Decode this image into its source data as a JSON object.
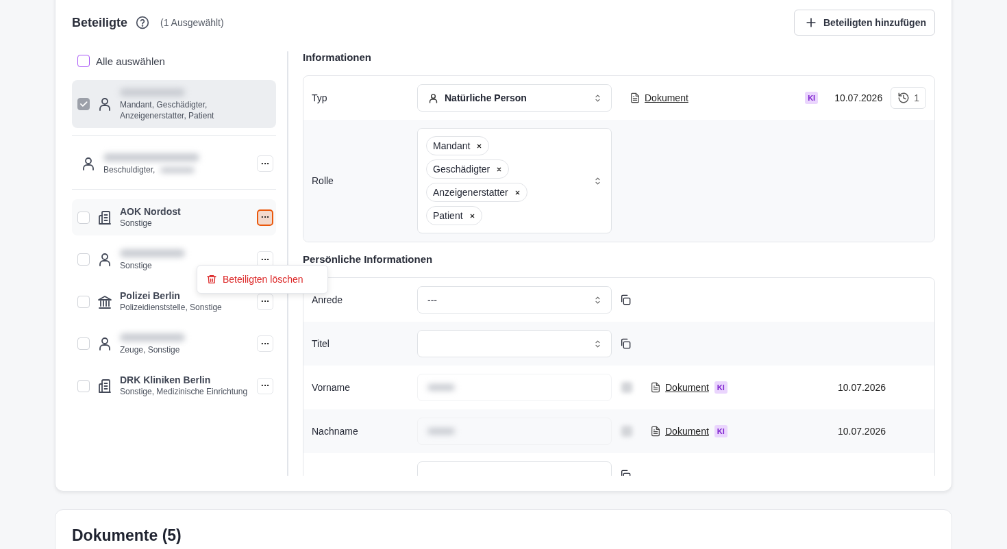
{
  "participants_panel": {
    "title": "Beteiligte",
    "selection_count": "(1 Ausgewählt)",
    "add_button": "Beteiligten hinzufügen",
    "select_all": {
      "label": "Alle auswählen",
      "checked": false
    },
    "participants": [
      {
        "kind": "person",
        "name_redacted": true,
        "roles": "Mandant, Geschädigter, Anzeigenerstatter, Patient",
        "checked": true,
        "selected": true,
        "menu_open": false,
        "divider_after": true
      },
      {
        "kind": "person",
        "name_redacted": true,
        "roles": "Beschuldigter,",
        "roles_redacted": true,
        "menu_button": "···",
        "menu_open": false,
        "selected": false,
        "divider_after": true
      },
      {
        "kind": "building",
        "name": "AOK Nordost",
        "roles": "Sonstige",
        "checked": false,
        "selected": false,
        "menu_button": "···",
        "menu_open": true,
        "divider_after": false
      },
      {
        "kind": "person",
        "name_redacted": true,
        "roles": "Sonstige",
        "checked": false,
        "selected": false,
        "menu_button": "···",
        "menu_open": false,
        "divider_after": false
      },
      {
        "kind": "institution",
        "name": "Polizei Berlin",
        "roles": "Polizeidienststelle, Sonstige",
        "checked": false,
        "selected": false,
        "menu_button": "···",
        "menu_open": false,
        "divider_after": false
      },
      {
        "kind": "person",
        "name_redacted": true,
        "roles": "Zeuge, Sonstige",
        "checked": false,
        "selected": false,
        "menu_button": "···",
        "menu_open": false,
        "divider_after": false
      },
      {
        "kind": "building",
        "name": "DRK Kliniken Berlin",
        "roles": "Sonstige, Medizinische Einrichtung",
        "checked": false,
        "selected": false,
        "menu_button": "···",
        "menu_open": false,
        "divider_after": false
      }
    ],
    "context_menu": {
      "items": [
        {
          "label": "Beteiligten löschen",
          "kind": "danger"
        }
      ]
    }
  },
  "details": {
    "sections": [
      {
        "title": "Informationen",
        "rows": [
          {
            "label": "Typ",
            "kind": "select",
            "value": "Natürliche Person",
            "source": "Dokument",
            "ki": "KI",
            "date": "10.07.2026",
            "history": "1"
          },
          {
            "label": "Rolle",
            "kind": "tags",
            "tags": [
              "Mandant",
              "Geschädigter",
              "Anzeigenerstatter",
              "Patient"
            ]
          }
        ]
      },
      {
        "title": "Persönliche Informationen",
        "rows": [
          {
            "label": "Anrede",
            "kind": "select",
            "value": "---",
            "copy": true
          },
          {
            "label": "Titel",
            "kind": "select",
            "copy": true
          },
          {
            "label": "Vorname",
            "kind": "redacted",
            "source": "Dokument",
            "ki": "KI",
            "date": "10.07.2026"
          },
          {
            "label": "Nachname",
            "kind": "redacted",
            "source": "Dokument",
            "ki": "KI",
            "date": "10.07.2026"
          },
          {
            "kind": "input",
            "copy": true
          }
        ]
      }
    ]
  },
  "documents_card": {
    "title": "Dokumente (5)"
  }
}
